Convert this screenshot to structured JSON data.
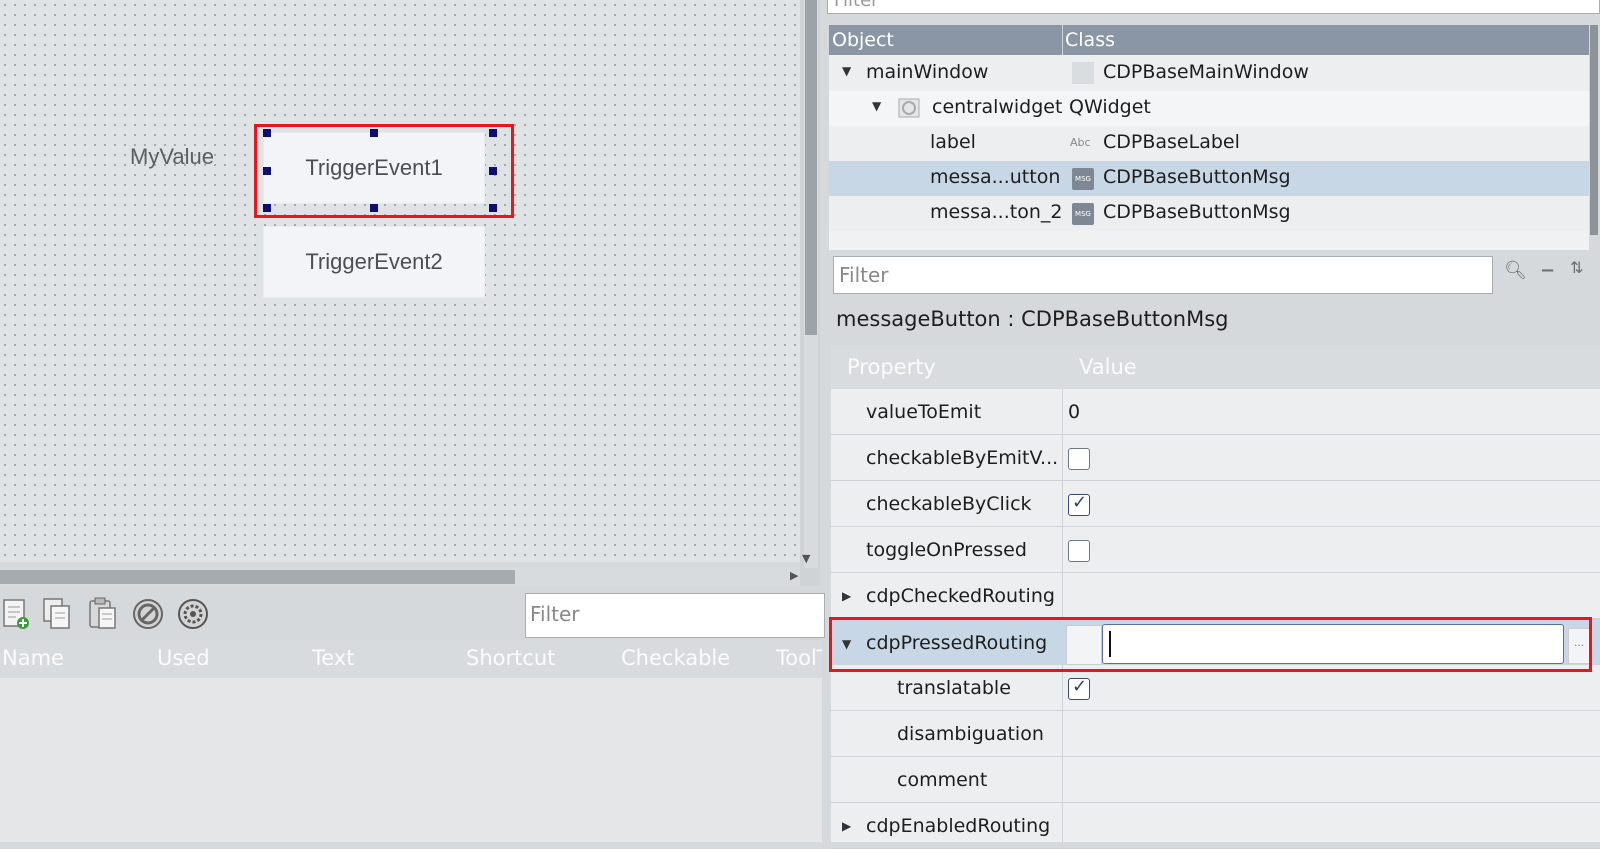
{
  "canvas": {
    "label": "MyValue",
    "button1": "TriggerEvent1",
    "button2": "TriggerEvent2"
  },
  "action_editor": {
    "filter_placeholder": "Filter",
    "columns": [
      "Name",
      "Used",
      "Text",
      "Shortcut",
      "Checkable",
      "ToolTip"
    ],
    "toolbar_icons": [
      "new-action-icon",
      "copy-icon",
      "paste-icon",
      "delete-icon",
      "configure-icon"
    ]
  },
  "object_inspector": {
    "filter_placeholder": "Filter",
    "columns": [
      "Object",
      "Class"
    ],
    "rows": [
      {
        "object": "mainWindow",
        "class": "CDPBaseMainWindow",
        "indent": 0,
        "expand": "down",
        "selected": false
      },
      {
        "object": "centralwidget",
        "class": "QWidget",
        "indent": 1,
        "expand": "down",
        "selected": false
      },
      {
        "object": "label",
        "class": "CDPBaseLabel",
        "indent": 2,
        "expand": "",
        "selected": false
      },
      {
        "object": "messa...utton",
        "class": "CDPBaseButtonMsg",
        "indent": 2,
        "expand": "",
        "selected": true
      },
      {
        "object": "messa...ton_2",
        "class": "CDPBaseButtonMsg",
        "indent": 2,
        "expand": "",
        "selected": false
      }
    ]
  },
  "property_editor": {
    "filter_placeholder": "Filter",
    "title": "messageButton : CDPBaseButtonMsg",
    "columns": [
      "Property",
      "Value"
    ],
    "rows": [
      {
        "name": "valueToEmit",
        "value": "0",
        "type": "text"
      },
      {
        "name": "checkableByEmitV...",
        "type": "checkbox",
        "checked": false
      },
      {
        "name": "checkableByClick",
        "type": "checkbox",
        "checked": true
      },
      {
        "name": "toggleOnPressed",
        "type": "checkbox",
        "checked": false
      },
      {
        "name": "cdpCheckedRouting",
        "type": "group",
        "expanded": false
      },
      {
        "name": "cdpPressedRouting",
        "type": "input",
        "expanded": true,
        "value": ""
      },
      {
        "name": "translatable",
        "type": "checkbox",
        "checked": true,
        "child": true
      },
      {
        "name": "disambiguation",
        "type": "text",
        "value": "",
        "child": true
      },
      {
        "name": "comment",
        "type": "text",
        "value": "",
        "child": true
      },
      {
        "name": "cdpEnabledRouting",
        "type": "group",
        "expanded": false
      }
    ]
  },
  "colors": {
    "highlight": "#e5161d",
    "selection_row": "#c8d7e6",
    "header": "#8a96a6"
  }
}
